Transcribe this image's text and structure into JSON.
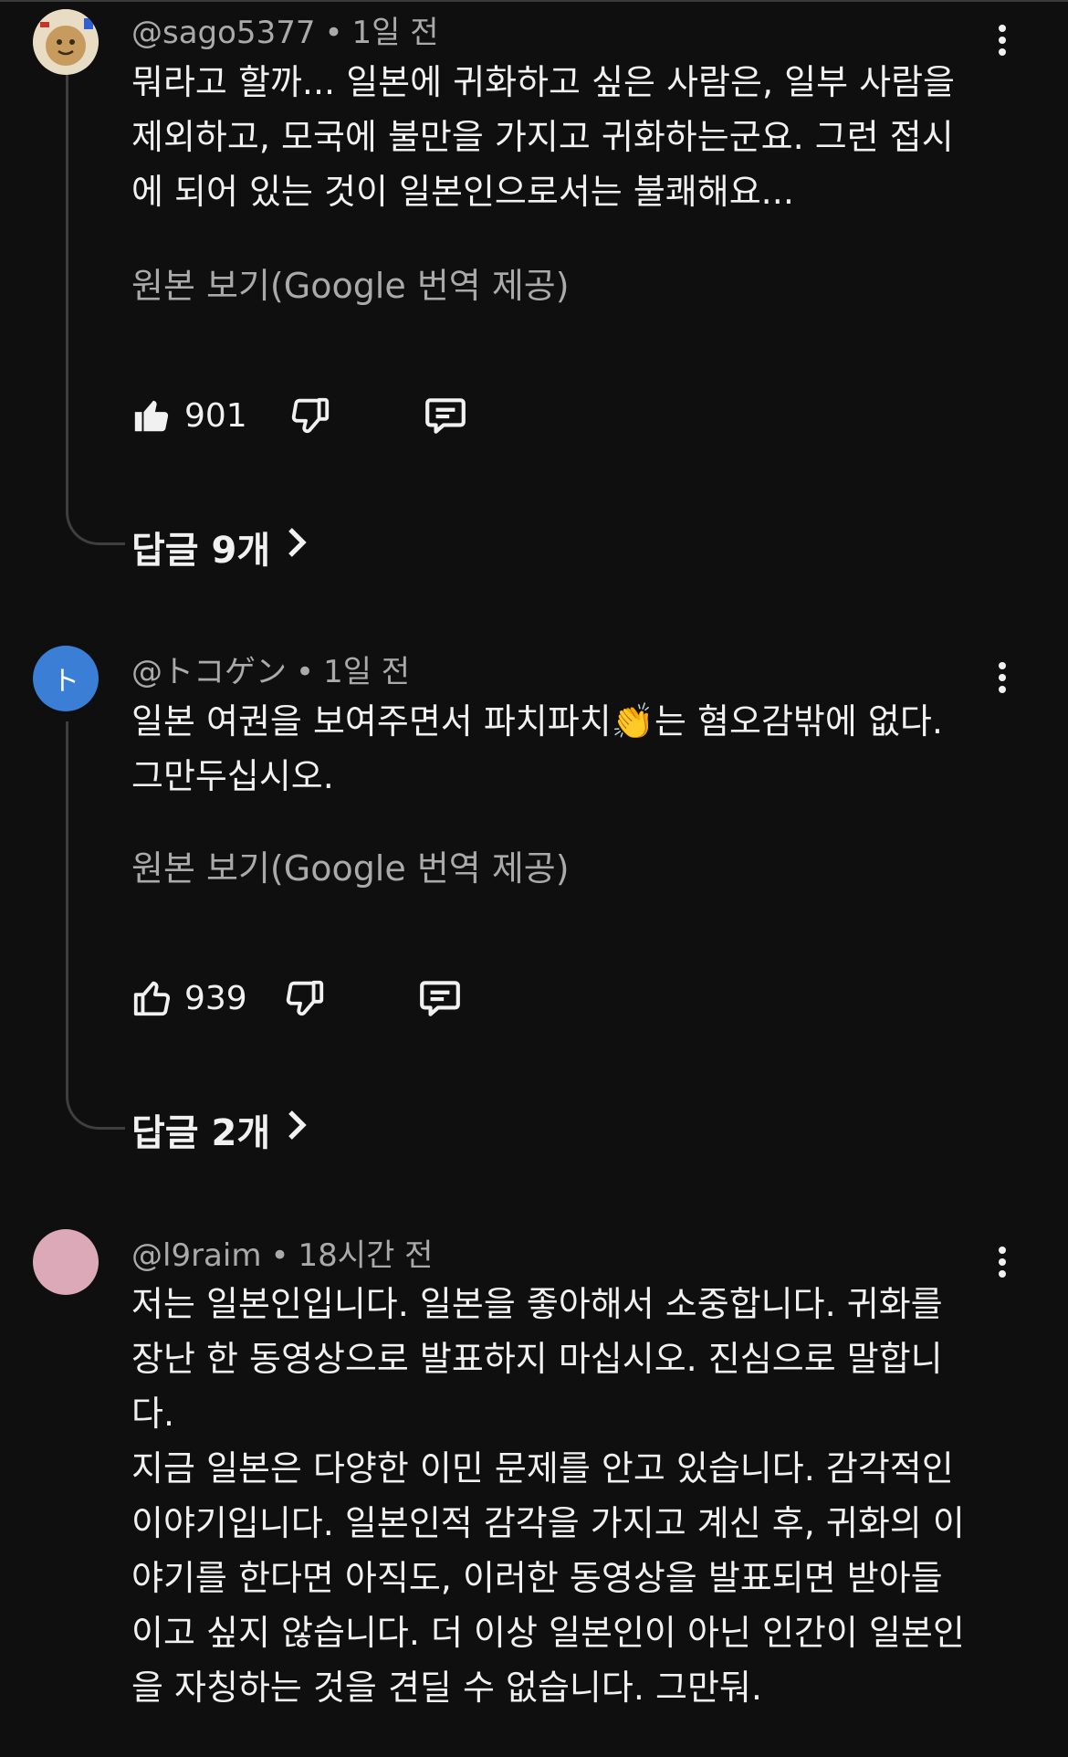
{
  "comments": [
    {
      "author": "@sago5377",
      "time": "1일 전",
      "text": "뭐라고 할까... 일본에 귀화하고 싶은 사람은, 일부 사람을\n제외하고, 모국에 불만을 가지고 귀화하는군요. 그런 접시\n에 되어 있는 것이 일본인으로서는 불쾌해요...",
      "translate_link": "원본 보기(Google 번역 제공)",
      "likes": "901",
      "like_filled": true,
      "replies_label": "답글 9개"
    },
    {
      "author": "@トコゲン",
      "avatar_letter": "ト",
      "time": "1일 전",
      "text": "일본 여권을 보여주면서 파치파치👏는 혐오감밖에 없다.\n그만두십시오.",
      "translate_link": "원본 보기(Google 번역 제공)",
      "likes": "939",
      "like_filled": false,
      "replies_label": "답글 2개"
    },
    {
      "author": "@l9raim",
      "time": "18시간 전",
      "text": "저는 일본인입니다. 일본을 좋아해서 소중합니다. 귀화를\n장난 한 동영상으로 발표하지 마십시오. 진심으로 말합니\n다.\n지금 일본은 다양한 이민 문제를 안고 있습니다. 감각적인\n이야기입니다. 일본인적 감각을 가지고 계신 후, 귀화의 이\n야기를 한다면 아직도, 이러한 동영상을 발표되면 받아들\n이고 싶지 않습니다. 더 이상 일본인이 아닌 인간이 일본인\n을 자칭하는 것을 견딜 수 없습니다. 그만둬."
    }
  ],
  "meta_separator": "•",
  "colors": {
    "background": "#0f0f0f",
    "text": "#f1f1f1",
    "secondary_text": "#aaaaaa",
    "avatar_blue": "#3b7ed6",
    "avatar_pink": "#dca9b8"
  },
  "icons": [
    "thumbs-up-icon",
    "thumbs-down-icon",
    "reply-comment-icon",
    "more-vert-icon",
    "chevron-right-icon"
  ]
}
